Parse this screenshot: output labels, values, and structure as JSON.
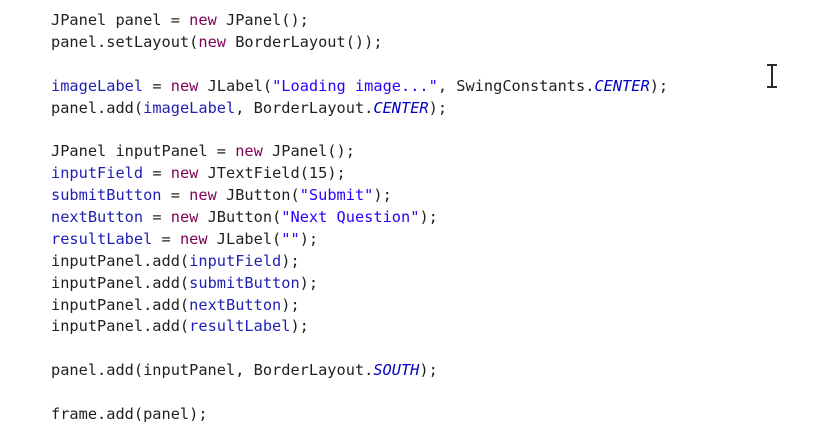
{
  "editor": {
    "lines": [
      [
        {
          "t": "JPanel panel = ",
          "c": "plain"
        },
        {
          "t": "new",
          "c": "kw"
        },
        {
          "t": " JPanel();",
          "c": "plain"
        }
      ],
      [
        {
          "t": "panel.setLayout(",
          "c": "plain"
        },
        {
          "t": "new",
          "c": "kw"
        },
        {
          "t": " BorderLayout());",
          "c": "plain"
        }
      ],
      [],
      [
        {
          "t": "imageLabel",
          "c": "field"
        },
        {
          "t": " = ",
          "c": "plain"
        },
        {
          "t": "new",
          "c": "kw"
        },
        {
          "t": " JLabel(",
          "c": "plain"
        },
        {
          "t": "\"Loading image...\"",
          "c": "str"
        },
        {
          "t": ", SwingConstants.",
          "c": "plain"
        },
        {
          "t": "CENTER",
          "c": "const"
        },
        {
          "t": ");",
          "c": "plain"
        }
      ],
      [
        {
          "t": "panel.add(",
          "c": "plain"
        },
        {
          "t": "imageLabel",
          "c": "field"
        },
        {
          "t": ", BorderLayout.",
          "c": "plain"
        },
        {
          "t": "CENTER",
          "c": "const"
        },
        {
          "t": ");",
          "c": "plain"
        }
      ],
      [],
      [
        {
          "t": "JPanel inputPanel = ",
          "c": "plain"
        },
        {
          "t": "new",
          "c": "kw"
        },
        {
          "t": " JPanel();",
          "c": "plain"
        }
      ],
      [
        {
          "t": "inputField",
          "c": "field"
        },
        {
          "t": " = ",
          "c": "plain"
        },
        {
          "t": "new",
          "c": "kw"
        },
        {
          "t": " JTextField(15);",
          "c": "plain"
        }
      ],
      [
        {
          "t": "submitButton",
          "c": "field"
        },
        {
          "t": " = ",
          "c": "plain"
        },
        {
          "t": "new",
          "c": "kw"
        },
        {
          "t": " JButton(",
          "c": "plain"
        },
        {
          "t": "\"Submit\"",
          "c": "str"
        },
        {
          "t": ");",
          "c": "plain"
        }
      ],
      [
        {
          "t": "nextButton",
          "c": "field"
        },
        {
          "t": " = ",
          "c": "plain"
        },
        {
          "t": "new",
          "c": "kw"
        },
        {
          "t": " JButton(",
          "c": "plain"
        },
        {
          "t": "\"Next Question\"",
          "c": "str"
        },
        {
          "t": ");",
          "c": "plain"
        }
      ],
      [
        {
          "t": "resultLabel",
          "c": "field"
        },
        {
          "t": " = ",
          "c": "plain"
        },
        {
          "t": "new",
          "c": "kw"
        },
        {
          "t": " JLabel(",
          "c": "plain"
        },
        {
          "t": "\"\"",
          "c": "str"
        },
        {
          "t": ");",
          "c": "plain"
        }
      ],
      [
        {
          "t": "inputPanel.add(",
          "c": "plain"
        },
        {
          "t": "inputField",
          "c": "field"
        },
        {
          "t": ");",
          "c": "plain"
        }
      ],
      [
        {
          "t": "inputPanel.add(",
          "c": "plain"
        },
        {
          "t": "submitButton",
          "c": "field"
        },
        {
          "t": ");",
          "c": "plain"
        }
      ],
      [
        {
          "t": "inputPanel.add(",
          "c": "plain"
        },
        {
          "t": "nextButton",
          "c": "field"
        },
        {
          "t": ");",
          "c": "plain"
        }
      ],
      [
        {
          "t": "inputPanel.add(",
          "c": "plain"
        },
        {
          "t": "resultLabel",
          "c": "field"
        },
        {
          "t": ");",
          "c": "plain"
        }
      ],
      [],
      [
        {
          "t": "panel.add(inputPanel, BorderLayout.",
          "c": "plain"
        },
        {
          "t": "SOUTH",
          "c": "const"
        },
        {
          "t": ");",
          "c": "plain"
        }
      ],
      [],
      [
        {
          "t": "frame.add(panel);",
          "c": "plain"
        }
      ]
    ]
  },
  "cursor": {
    "icon": "text-cursor-icon"
  }
}
